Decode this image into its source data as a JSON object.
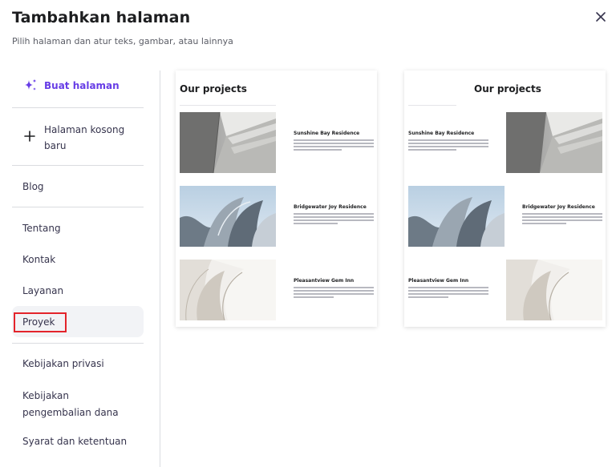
{
  "dialog": {
    "title": "Tambahkan halaman",
    "subtitle": "Pilih halaman dan atur teks, gambar, atau lainnya",
    "close_icon": "close-icon"
  },
  "sidebar": {
    "create": {
      "label": "Buat halaman",
      "icon": "sparkle-icon",
      "color": "#673de6"
    },
    "blank": {
      "label": "Halaman kosong baru",
      "icon": "plus-icon"
    },
    "items": [
      {
        "label": "Blog"
      },
      {
        "label": "Tentang"
      },
      {
        "label": "Kontak"
      },
      {
        "label": "Layanan"
      },
      {
        "label": "Proyek",
        "selected": true
      },
      {
        "label": "Kebijakan privasi"
      },
      {
        "label": "Kebijakan pengembalian dana"
      },
      {
        "label": "Syarat dan ketentuan"
      }
    ]
  },
  "templates": [
    {
      "title": "Our projects",
      "layout": "image-left",
      "projects": [
        {
          "name": "Sunshine Bay Residence"
        },
        {
          "name": "Bridgewater Joy Residence"
        },
        {
          "name": "Pleasantview Gem Inn"
        }
      ]
    },
    {
      "title": "Our projects",
      "layout": "alternating",
      "projects": [
        {
          "name": "Sunshine Bay Residence"
        },
        {
          "name": "Bridgewater Joy Residence"
        },
        {
          "name": "Pleasantview Gem Inn"
        }
      ]
    }
  ],
  "colors": {
    "accent": "#673de6",
    "selection_outline": "#e3242b",
    "selected_bg": "#f2f3f6"
  }
}
